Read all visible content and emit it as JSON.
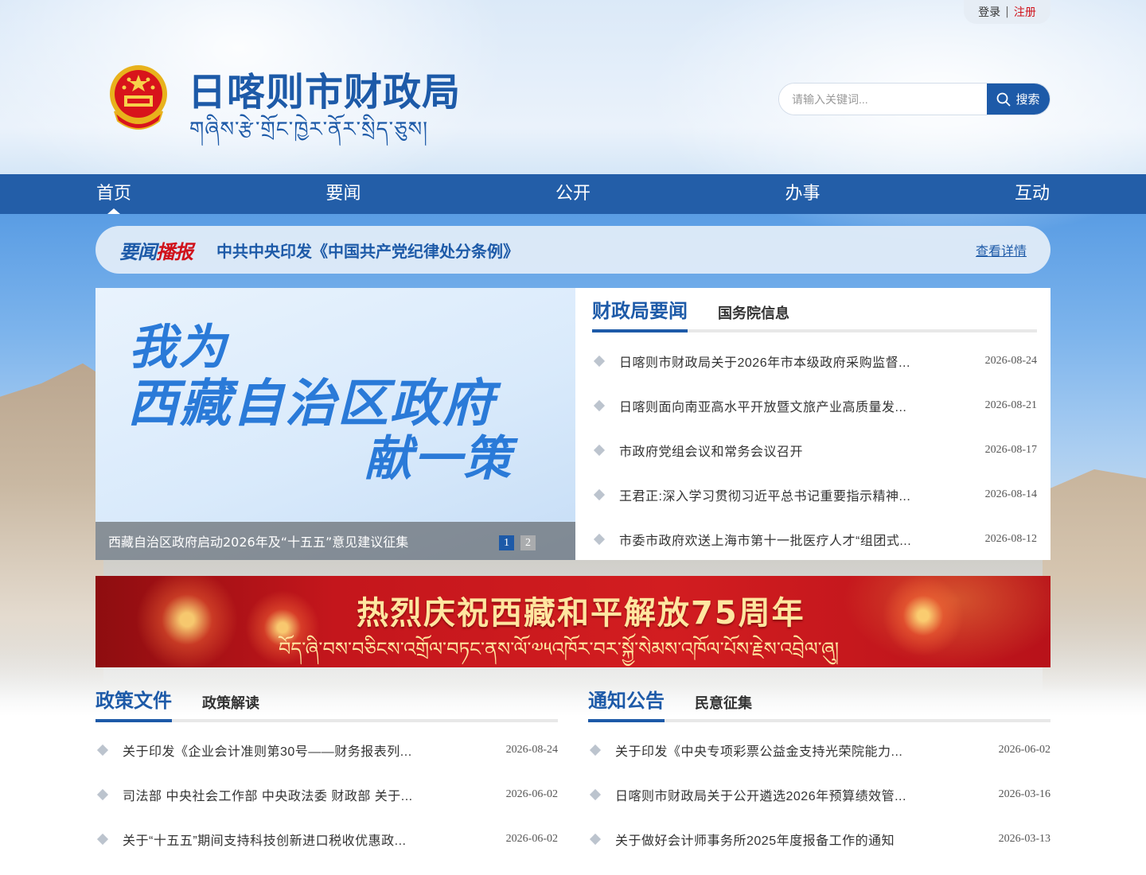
{
  "top_links": {
    "login": "登录",
    "separator": "|",
    "register": "注册"
  },
  "header": {
    "title": "日喀则市财政局",
    "subtitle": "གཞིས་རྩེ་གྲོང་ཁྱེར་ནོར་སྲིད་ཅུས།"
  },
  "search": {
    "placeholder": "请输入关键词...",
    "button_label": "搜索"
  },
  "nav": {
    "items": [
      {
        "label": "首页",
        "active": true
      },
      {
        "label": "要闻"
      },
      {
        "label": "公开"
      },
      {
        "label": "办事"
      },
      {
        "label": "互动"
      }
    ]
  },
  "headline": {
    "logo_part1": "要闻",
    "logo_part2": "播报",
    "text": "中共中央印发《中国共产党纪律处分条例》",
    "more_label": "查看详情"
  },
  "slider": {
    "line1": "我为",
    "line2": "西藏自治区政府",
    "line3": "献一策",
    "caption": "西藏自治区政府启动2026年及“十五五”意见建议征集",
    "dots": [
      "1",
      "2"
    ],
    "active_dot": 0
  },
  "news_panel": {
    "tabs": [
      "财政局要闻",
      "国务院信息"
    ],
    "items": [
      {
        "title": "日喀则市财政局关于2026年市本级政府采购监督...",
        "date": "2026-08-24"
      },
      {
        "title": "日喀则面向南亚高水平开放暨文旅产业高质量发...",
        "date": "2026-08-21"
      },
      {
        "title": "市政府党组会议和常务会议召开",
        "date": "2026-08-17"
      },
      {
        "title": "王君正:深入学习贯彻习近平总书记重要指示精神...",
        "date": "2026-08-14"
      },
      {
        "title": "市委市政府欢送上海市第十一批医疗人才“组团式...",
        "date": "2026-08-12"
      }
    ]
  },
  "banner": {
    "title": "热烈庆祝西藏和平解放75周年",
    "subtitle": "བོད་ཞི་བས་བཅིངས་འགྲོལ་བཏང་ནས་ལོ་༧༥འཁོར་བར་སྐྱོ་སེམས་འཁོལ་པོས་རྗེས་འབྲེལ་ཞུ།"
  },
  "policy": {
    "tabs": [
      "政策文件",
      "政策解读"
    ],
    "items": [
      {
        "title": "关于印发《企业会计准则第30号——财务报表列...",
        "date": "2026-08-24"
      },
      {
        "title": "司法部 中央社会工作部 中央政法委 财政部 关于...",
        "date": "2026-06-02"
      },
      {
        "title": "关于“十五五”期间支持科技创新进口税收优惠政...",
        "date": "2026-06-02"
      }
    ]
  },
  "notice": {
    "tabs": [
      "通知公告",
      "民意征集"
    ],
    "items": [
      {
        "title": "关于印发《中央专项彩票公益金支持光荣院能力...",
        "date": "2026-06-02"
      },
      {
        "title": "日喀则市财政局关于公开遴选2026年预算绩效管...",
        "date": "2026-03-16"
      },
      {
        "title": "关于做好会计师事务所2025年度报备工作的通知",
        "date": "2026-03-13"
      }
    ]
  },
  "colors": {
    "brand_blue": "#1d5aa8",
    "nav_blue": "#235ea8",
    "accent_red": "#d0121b"
  }
}
